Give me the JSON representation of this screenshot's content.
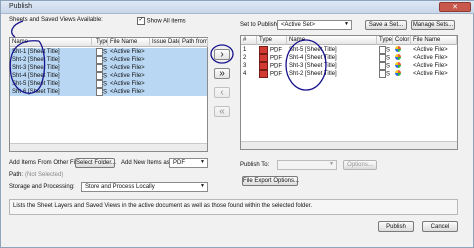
{
  "window": {
    "title": "Publish",
    "close_label": "✕"
  },
  "left": {
    "heading": "Sheets and Saved Views Available:",
    "show_all_label": "Show All items",
    "show_all_checked": true,
    "columns": [
      "Name",
      "Type",
      "File Name",
      "Issue Date",
      "Path from"
    ],
    "rows": [
      {
        "name": "Sht-1 [Sheet Title]",
        "type": "S",
        "file": "<Active File>"
      },
      {
        "name": "Sht-2 [Sheet Title]",
        "type": "S",
        "file": "<Active File>"
      },
      {
        "name": "Sht-3 [Sheet Title]",
        "type": "S",
        "file": "<Active File>"
      },
      {
        "name": "Sht-4 [Sheet Title]",
        "type": "S",
        "file": "<Active File>"
      },
      {
        "name": "Sht-5 [Sheet Title]",
        "type": "S",
        "file": "<Active File>"
      },
      {
        "name": "Sht-6 [Sheet Title]",
        "type": "S",
        "file": "<Active File>"
      }
    ],
    "add_other_files_label": "Add Items From Other Files:",
    "select_folder_label": "Select Folder...",
    "add_new_items_as_label": "Add New Items as:",
    "add_new_items_as_value": "PDF",
    "path_label": "Path:",
    "path_value": "(Not Selected)",
    "storage_label": "Storage and Processing:",
    "storage_value": "Store and Process Locally"
  },
  "right": {
    "set_label": "Set to Publish:",
    "set_value": "<Active Set>",
    "save_set_label": "Save a Set...",
    "manage_sets_label": "Manage Sets...",
    "columns": [
      "#",
      "Type",
      "Name",
      "Type",
      "Color",
      "File Name"
    ],
    "rows": [
      {
        "num": "1",
        "type": "PDF",
        "name": "Sht-5 [Sheet Title]",
        "kind": "S",
        "file": "<Active File>"
      },
      {
        "num": "2",
        "type": "PDF",
        "name": "Sht-4 [Sheet Title]",
        "kind": "S",
        "file": "<Active File>"
      },
      {
        "num": "3",
        "type": "PDF",
        "name": "Sht-3 [Sheet Title]",
        "kind": "S",
        "file": "<Active File>"
      },
      {
        "num": "4",
        "type": "PDF",
        "name": "Sht-2 [Sheet Title]",
        "kind": "S",
        "file": "<Active File>"
      }
    ],
    "publish_to_label": "Publish To:",
    "options_label": "Options...",
    "file_export_label": "File Export Options..."
  },
  "status_text": "Lists the Sheet Layers and Saved Views in the active document as well as those found within the selected folder.",
  "footer": {
    "publish_label": "Publish",
    "cancel_label": "Cancel"
  },
  "arrows": [
    "›",
    "»",
    "‹",
    "«"
  ]
}
